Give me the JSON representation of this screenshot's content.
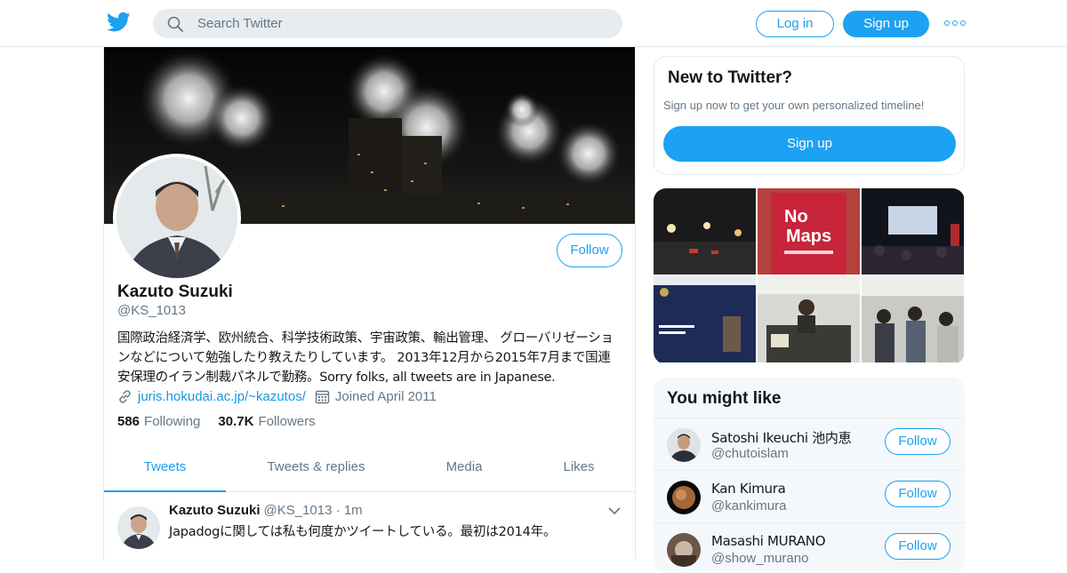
{
  "header": {
    "search_placeholder": "Search Twitter",
    "login_label": "Log in",
    "signup_label": "Sign up",
    "brand_color": "#1da1f2"
  },
  "profile": {
    "name": "Kazuto Suzuki",
    "handle": "@KS_1013",
    "follow_label": "Follow",
    "bio": "国際政治経済学、欧州統合、科学技術政策、宇宙政策、輸出管理、 グローバリゼーションなどについて勉強したり教えたりしています。 2013年12月から2015年7月まで国連安保理のイラン制裁パネルで勤務。Sorry folks, all tweets are in Japanese.",
    "website": "juris.hokudai.ac.jp/~kazutos/",
    "joined": "Joined April 2011",
    "following_count": "586",
    "following_label": "Following",
    "followers_count": "30.7K",
    "followers_label": "Followers"
  },
  "tabs": [
    {
      "label": "Tweets",
      "active": true
    },
    {
      "label": "Tweets & replies",
      "active": false
    },
    {
      "label": "Media",
      "active": false
    },
    {
      "label": "Likes",
      "active": false
    }
  ],
  "tweet": {
    "name": "Kazuto Suzuki",
    "handle": "@KS_1013",
    "dot": "·",
    "time": "1m",
    "text": "Japadogに関しては私も何度かツイートしている。最初は2014年。"
  },
  "new_to_twitter": {
    "title": "New to Twitter?",
    "subtitle": "Sign up now to get your own personalized timeline!",
    "signup_label": "Sign up"
  },
  "you_might_like": {
    "title": "You might like",
    "users": [
      {
        "name": "Satoshi Ikeuchi 池内恵",
        "handle": "@chutoislam",
        "follow_label": "Follow"
      },
      {
        "name": "Kan Kimura",
        "handle": "@kankimura",
        "follow_label": "Follow"
      },
      {
        "name": "Masashi MURANO",
        "handle": "@show_murano",
        "follow_label": "Follow"
      }
    ]
  }
}
